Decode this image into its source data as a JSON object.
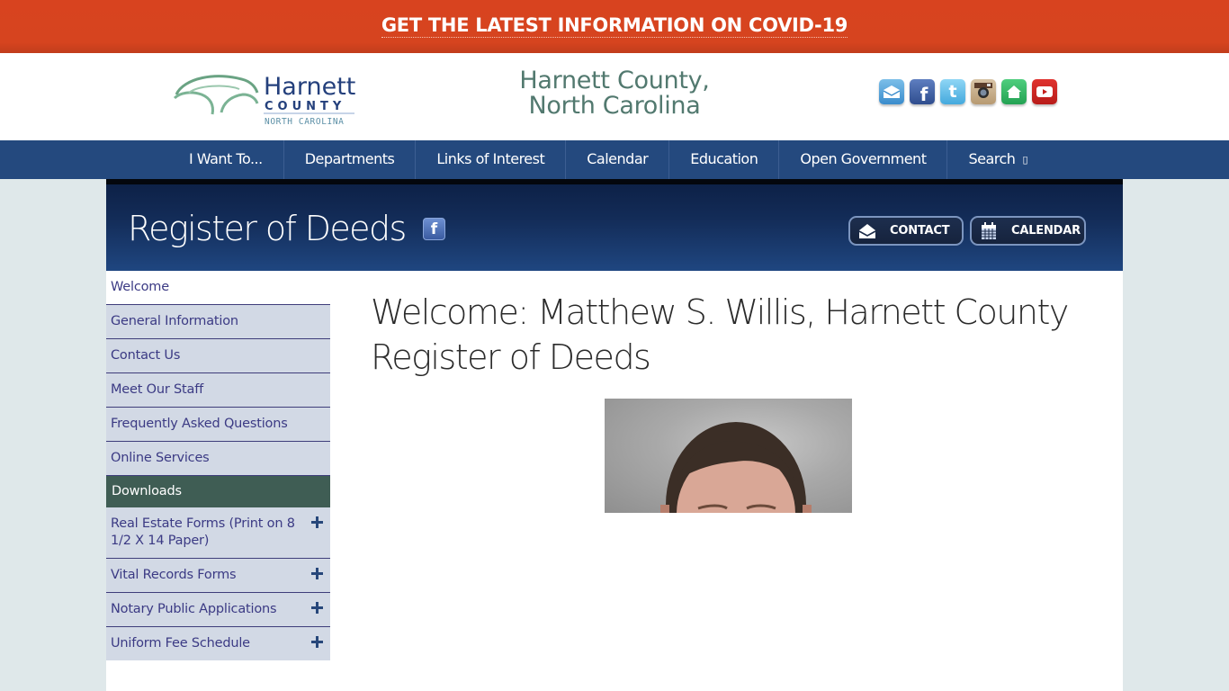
{
  "banner": {
    "text": "GET THE LATEST INFORMATION ON COVID-19",
    "color": "#d8431f"
  },
  "header": {
    "logo": {
      "line1": "Harnett",
      "line2": "COUNTY",
      "line3": "NORTH CAROLINA"
    },
    "site_title_line1": "Harnett County,",
    "site_title_line2": "North Carolina",
    "social": [
      {
        "name": "email",
        "icon": "email-icon"
      },
      {
        "name": "facebook",
        "icon": "facebook-icon"
      },
      {
        "name": "twitter",
        "icon": "twitter-icon"
      },
      {
        "name": "instagram",
        "icon": "instagram-icon"
      },
      {
        "name": "nextdoor",
        "icon": "home-icon"
      },
      {
        "name": "youtube",
        "icon": "youtube-icon"
      }
    ]
  },
  "nav": {
    "items": [
      {
        "label": "I Want To..."
      },
      {
        "label": "Departments"
      },
      {
        "label": "Links of Interest"
      },
      {
        "label": "Calendar"
      },
      {
        "label": "Education"
      },
      {
        "label": "Open Government"
      },
      {
        "label": "Search",
        "glyph": "▯"
      }
    ]
  },
  "department": {
    "title": "Register of Deeds",
    "fb_glyph": "f",
    "contact_label": "CONTACT",
    "calendar_label": "CALENDAR"
  },
  "sidebar": {
    "items": [
      {
        "label": "Welcome",
        "state": "current"
      },
      {
        "label": "General Information"
      },
      {
        "label": "Contact Us"
      },
      {
        "label": "Meet Our Staff"
      },
      {
        "label": "Frequently Asked Questions"
      },
      {
        "label": "Online Services"
      },
      {
        "label": "Downloads",
        "state": "section-header"
      },
      {
        "label": "Real Estate Forms (Print on 8 1/2 X 14 Paper)",
        "expandable": true
      },
      {
        "label": "Vital Records Forms",
        "expandable": true
      },
      {
        "label": "Notary Public Applications",
        "expandable": true
      },
      {
        "label": "Uniform Fee Schedule",
        "expandable": true
      }
    ]
  },
  "main": {
    "title": "Welcome: Matthew S. Willis, Harnett County Register of Deeds",
    "photo_alt": "Portrait of Matthew S. Willis"
  },
  "colors": {
    "nav_bg": "#24497e",
    "page_bg": "#dfe8ea",
    "sidebar_bg": "#d2d9e5",
    "sidebar_text": "#3b3a84",
    "downloads_bg": "#3f5d54",
    "site_title": "#52796f"
  }
}
